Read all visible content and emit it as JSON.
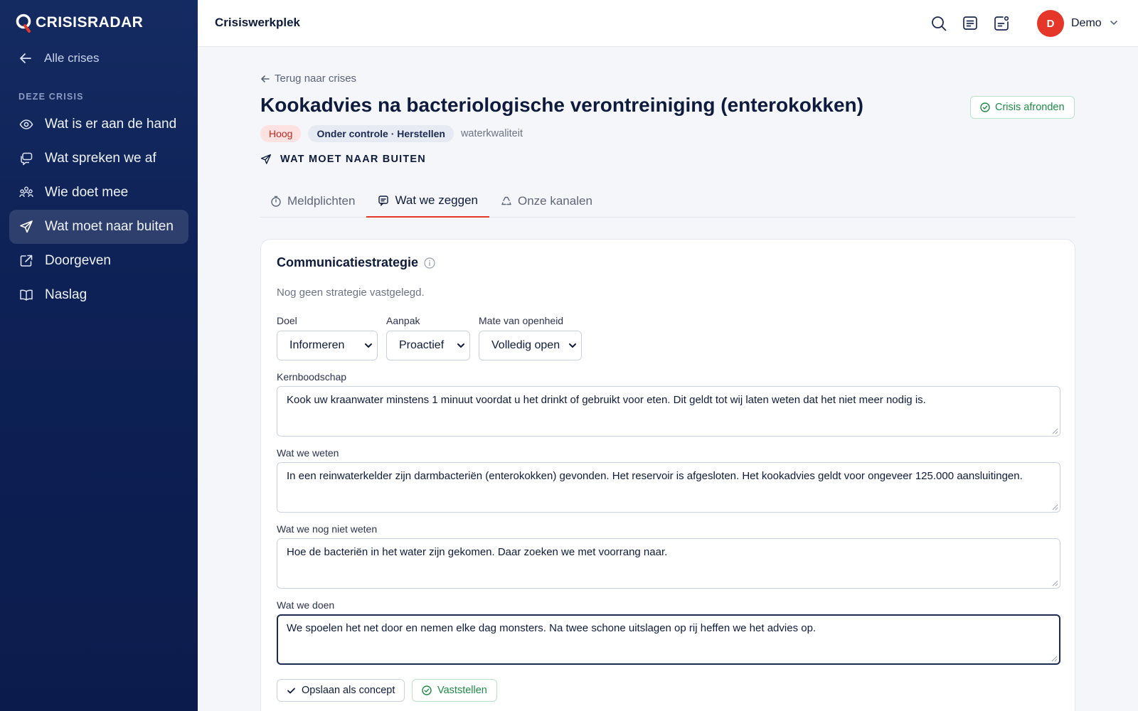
{
  "app": {
    "brand": "CRISISRADAR",
    "workspace_title": "Crisiswerkplek"
  },
  "sidebar": {
    "back_label": "Alle crises",
    "section_label": "DEZE CRISIS",
    "items": [
      {
        "label": "Wat is er aan de hand",
        "icon": "eye-icon"
      },
      {
        "label": "Wat spreken we af",
        "icon": "chat-icon"
      },
      {
        "label": "Wie doet mee",
        "icon": "people-icon"
      },
      {
        "label": "Wat moet naar buiten",
        "icon": "send-icon",
        "active": true
      },
      {
        "label": "Doorgeven",
        "icon": "external-link-icon"
      },
      {
        "label": "Naslag",
        "icon": "book-icon"
      }
    ]
  },
  "header": {
    "user_initial": "D",
    "user_name": "Demo"
  },
  "page": {
    "breadcrumb": "Terug naar crises",
    "title": "Kookadvies na bacteriologische verontreiniging (enterokokken)",
    "close_button": "Crisis afronden",
    "tags": {
      "priority": "Hoog",
      "status": "Onder controle · Herstellen",
      "category": "waterkwaliteit"
    },
    "section_heading": "WAT MOET NAAR BUITEN",
    "tabs": [
      {
        "label": "Meldplichten",
        "icon": "stopwatch-icon"
      },
      {
        "label": "Wat we zeggen",
        "icon": "message-icon",
        "active": true
      },
      {
        "label": "Onze kanalen",
        "icon": "recycle-icon"
      }
    ]
  },
  "strategy": {
    "title": "Communicatiestrategie",
    "empty_text": "Nog geen strategie vastgelegd.",
    "goal": {
      "label": "Doel",
      "value": "Informeren"
    },
    "approach": {
      "label": "Aanpak",
      "value": "Proactief"
    },
    "openness": {
      "label": "Mate van openheid",
      "value": "Volledig open"
    },
    "key_message": {
      "label": "Kernboodschap",
      "value": "Kook uw kraanwater minstens 1 minuut voordat u het drinkt of gebruikt voor eten. Dit geldt tot wij laten weten dat het niet meer nodig is."
    },
    "known": {
      "label": "Wat we weten",
      "value": "In een reinwaterkelder zijn darmbacteriën (enterokokken) gevonden. Het reservoir is afgesloten. Het kookadvies geldt voor ongeveer 125.000 aansluitingen."
    },
    "unknown": {
      "label": "Wat we nog niet weten",
      "value": "Hoe de bacteriën in het water zijn gekomen. Daar zoeken we met voorrang naar."
    },
    "actions": {
      "label": "Wat we doen",
      "value": "We spoelen het net door en nemen elke dag monsters. Na twee schone uitslagen op rij heffen we het advies op."
    },
    "save_draft": "Opslaan als concept",
    "confirm": "Vaststellen"
  },
  "colors": {
    "sidebar_bg": "#0e2156",
    "accent_red": "#e5362a",
    "success_green": "#1d8a45"
  }
}
